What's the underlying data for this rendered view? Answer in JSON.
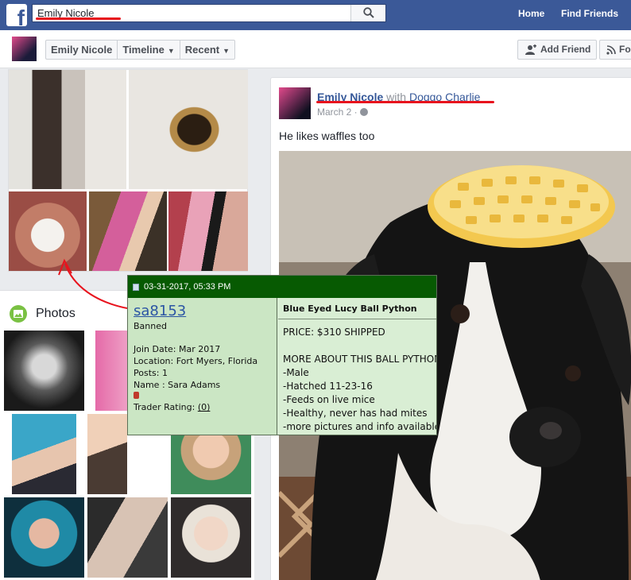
{
  "topbar": {
    "logo": "f",
    "search_value": "Emily Nicole",
    "nav": {
      "home": "Home",
      "find_friends": "Find Friends"
    }
  },
  "profile_header": {
    "crumbs": [
      "Emily Nicole",
      "Timeline",
      "Recent"
    ],
    "add_friend": "Add Friend",
    "follow": "Follow"
  },
  "left": {
    "photos_title": "Photos"
  },
  "post": {
    "author": "Emily Nicole",
    "with_text": "with",
    "tagged": "Doggo Charlie",
    "date": "March 2 ·",
    "text": "He likes waffles too"
  },
  "forum": {
    "timestamp": "03-31-2017, 05:33 PM",
    "username": "sa8153",
    "status": "Banned",
    "join_date": "Join Date: Mar 2017",
    "location": "Location: Fort Myers, Florida",
    "posts": "Posts: 1",
    "name": "Name : Sara Adams",
    "trader_rating_label": "Trader Rating: ",
    "trader_rating_value": "(0)",
    "post_title": "Blue Eyed Lucy Ball Python",
    "price": "PRICE: $310 SHIPPED",
    "more_about": "MORE ABOUT THIS BALL PYTHON",
    "details": [
      "-Male",
      "-Hatched 11-23-16",
      "-Feeds on live mice",
      "-Healthy, never has had mites",
      "-more pictures and info available"
    ]
  },
  "colors": {
    "fb_blue": "#3b5998",
    "link_blue": "#365899",
    "annotation_red": "#e8131d",
    "forum_header_green": "#075a02",
    "forum_body": "#d9eed4"
  }
}
